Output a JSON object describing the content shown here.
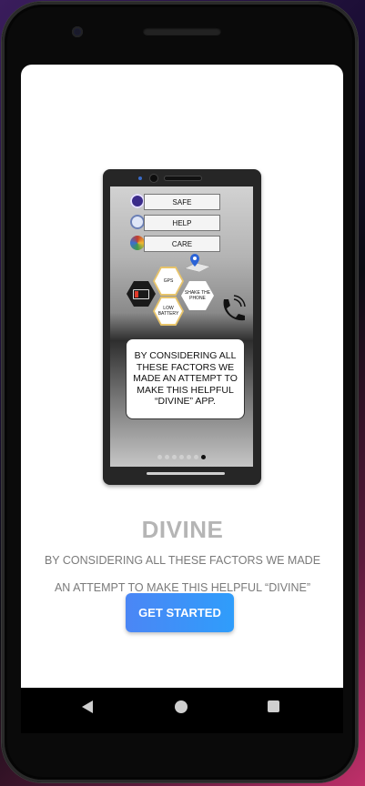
{
  "onboarding": {
    "illustration": {
      "rows": [
        {
          "label": "SAFE",
          "icon": "shield-icon",
          "color": "#3b2b8a"
        },
        {
          "label": "HELP",
          "icon": "help-hand-icon",
          "color": "#6b7fb4"
        },
        {
          "label": "CARE",
          "icon": "care-icon",
          "color": "#c23b2e"
        }
      ],
      "hexagons": [
        "GPS",
        "SHAKE THE PHONE",
        "LOW BATTERY"
      ],
      "message": "BY CONSIDERING ALL THESE FACTORS WE MADE AN ATTEMPT TO MAKE THIS HELPFUL “DIVINE” APP.",
      "page_count": 7,
      "active_page": 7
    },
    "title": "DIVINE",
    "description_line1": "BY CONSIDERING ALL THESE FACTORS WE MADE",
    "description_line2": "AN ATTEMPT TO MAKE THIS HELPFUL “DIVINE”",
    "get_started_label": "GET STARTED"
  },
  "colors": {
    "accent_start": "#4b86f5",
    "accent_end": "#2f9dfb",
    "title": "#b5b5b5"
  }
}
